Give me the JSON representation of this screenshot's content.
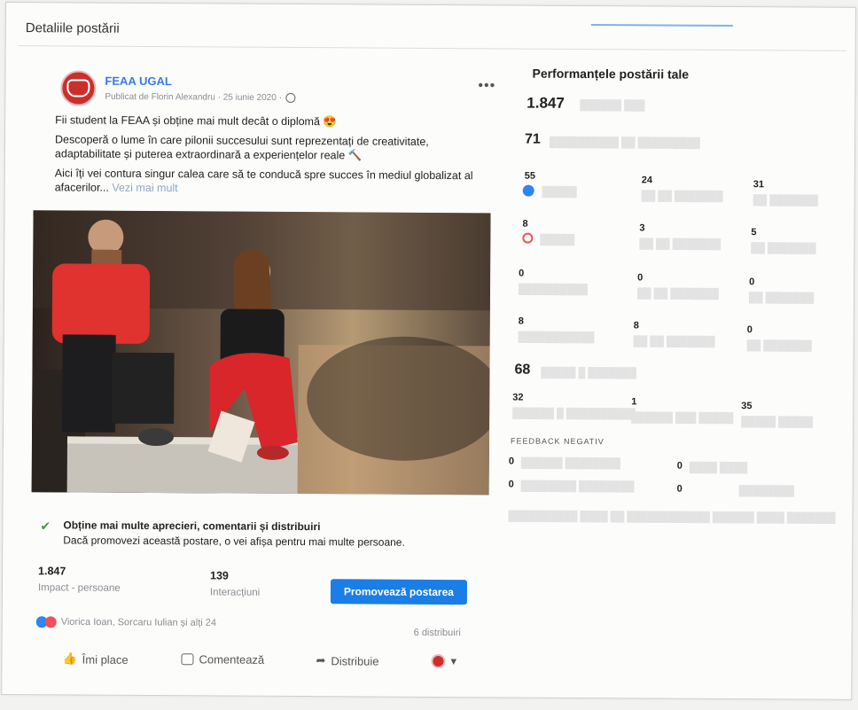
{
  "dialog": {
    "title": "Detaliile postării"
  },
  "post": {
    "page_name": "FEAA UGAL",
    "meta": "Publicat de Florin Alexandru · 25 iunie 2020 ·",
    "paragraphs": [
      "Fii student la FEAA și obține mai mult decât o diplomă 😍",
      "Descoperă o lume în care pilonii succesului sunt reprezentați de creativitate, adaptabilitate și puterea extraordinară a experiențelor reale 🔨",
      "Aici îți vei contura singur calea care să te conducă spre succes în mediul globalizat al afacerilor..."
    ],
    "see_more": "Vezi mai mult",
    "photo_alt": ""
  },
  "promo": {
    "title": "Obține mai multe aprecieri, comentarii și distribuiri",
    "subtitle": "Dacă promovezi această postare, o vei afișa pentru mai multe persoane."
  },
  "stats": {
    "reach_value": "1.847",
    "reach_label": "Impact - persoane",
    "interactions_value": "139",
    "interactions_label": "Interacțiuni",
    "promote_button": "Promovează postarea"
  },
  "reactions": {
    "names": "Viorica Ioan, Sorcaru Iulian și alți 24",
    "shares": "6 distribuiri"
  },
  "actions": {
    "like": "Îmi place",
    "comment": "Comentează",
    "share": "Distribuie"
  },
  "performance": {
    "title": "Performanțele postării tale",
    "reach": "1.847",
    "engagement": "71",
    "rows": [
      [
        "55",
        "24",
        "31"
      ],
      [
        "8",
        "3",
        "5"
      ],
      [
        "0",
        "0",
        "0"
      ],
      [
        "8",
        "8",
        "0"
      ]
    ],
    "clicks_total": "68",
    "clicks": [
      "32",
      "1",
      "35"
    ],
    "negative_heading": "FEEDBACK NEGATIV",
    "negative_rows": [
      [
        "0",
        "0"
      ],
      [
        "0",
        "0"
      ]
    ]
  },
  "colors": {
    "accent": "#1a7ee6",
    "page_name": "#3578e5",
    "like": "#2d87f0",
    "love": "#f0505b",
    "brand_red": "#c9302c"
  }
}
